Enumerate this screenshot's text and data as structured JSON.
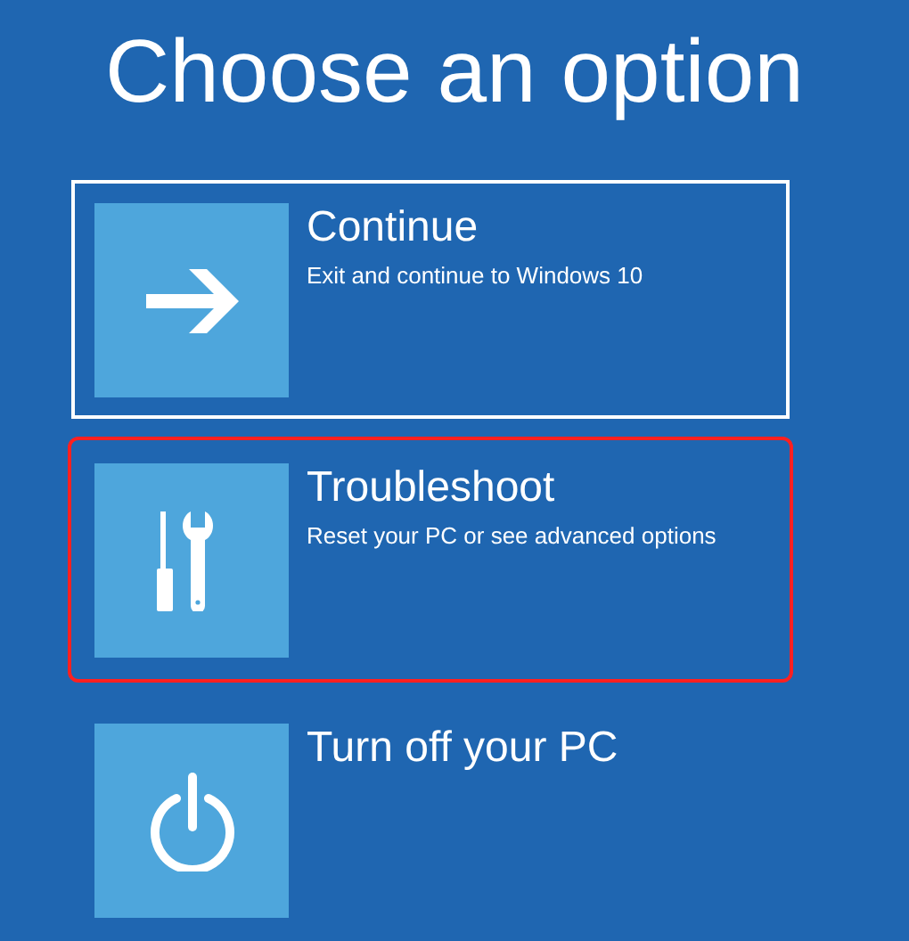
{
  "title": "Choose an option",
  "options": [
    {
      "kind": "arrow",
      "label": "Continue",
      "description": "Exit and continue to Windows 10",
      "focused": true,
      "highlighted": false
    },
    {
      "kind": "tools",
      "label": "Troubleshoot",
      "description": "Reset your PC or see advanced options",
      "focused": false,
      "highlighted": true
    },
    {
      "kind": "power",
      "label": "Turn off your PC",
      "focused": false,
      "highlighted": false
    }
  ]
}
